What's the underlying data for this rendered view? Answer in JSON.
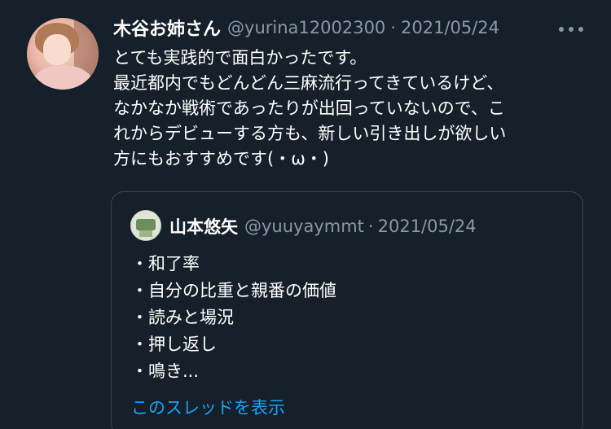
{
  "tweet": {
    "author_name": "木谷お姉さん",
    "author_handle": "@yurina12002300",
    "separator": "·",
    "date": "2021/05/24",
    "body_lines": [
      "とても実践的で面白かったです。",
      "最近都内でもどんどん三麻流行ってきているけど、",
      "なかなか戦術であったりが出回っていないので、こ",
      "れからデビューする方も、新しい引き出しが欲しい",
      "方にもおすすめです(・ω・)"
    ]
  },
  "quote": {
    "author_name": "山本悠矢",
    "author_handle": "@yuuyaymmt",
    "separator": "·",
    "date": "2021/05/24",
    "items": [
      "・和了率",
      "・自分の比重と親番の価値",
      "・読みと場況",
      "・押し返し",
      "・鳴き..."
    ],
    "show_thread_label": "このスレッドを表示"
  },
  "colors": {
    "background": "#15202b",
    "text_primary": "#ffffff",
    "text_secondary": "#8899a6",
    "link": "#1da1f2",
    "border": "#38444d"
  },
  "icons": {
    "more": "more-horizontal-icon"
  }
}
